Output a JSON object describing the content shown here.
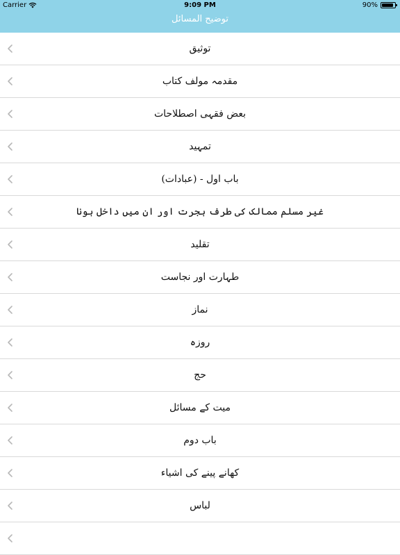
{
  "status": {
    "carrier": "Carrier",
    "time": "9:09 PM",
    "battery": "90%",
    "battery_level": 0.9
  },
  "nav": {
    "title": "توضیح المسائل"
  },
  "items": [
    {
      "label": "توثیق"
    },
    {
      "label": "مقدمہ مولف کتاب"
    },
    {
      "label": "بعض فقہی اصطلاحات"
    },
    {
      "label": "تمہید"
    },
    {
      "label": "باب اول - (عبادات)"
    },
    {
      "label": "غیر مسلم ممالک کی طرف ہجرت اور ان میں داخل ہونا"
    },
    {
      "label": "تقلید"
    },
    {
      "label": "طہارت اور نجاست"
    },
    {
      "label": "نماز"
    },
    {
      "label": "روزہ"
    },
    {
      "label": "حج"
    },
    {
      "label": "میت کے مسائل"
    },
    {
      "label": "باب دوم"
    },
    {
      "label": "کھانے پینے کی اشیاء"
    },
    {
      "label": "لباس"
    },
    {
      "label": ""
    }
  ]
}
